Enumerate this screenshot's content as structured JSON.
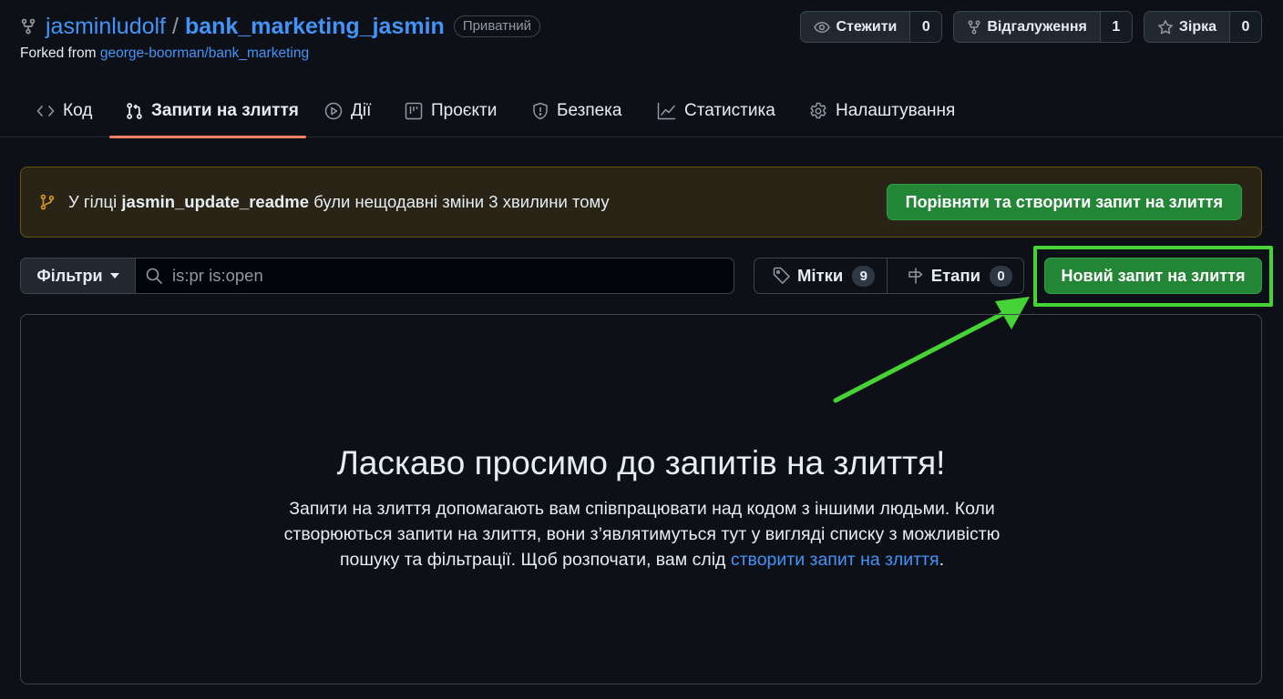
{
  "repo": {
    "owner": "jasminludolf",
    "separator": "/",
    "name": "bank_marketing_jasmin",
    "visibility": "Приватний",
    "forked_prefix": "Forked from",
    "forked_from": "george-boorman/bank_marketing"
  },
  "header_actions": {
    "watch": {
      "label": "Стежити",
      "count": "0",
      "icon": "eye-icon"
    },
    "fork": {
      "label": "Відгалуження",
      "count": "1",
      "icon": "repo-forked-icon"
    },
    "star": {
      "label": "Зірка",
      "count": "0",
      "icon": "star-icon"
    }
  },
  "tabs": [
    {
      "label": "Код",
      "icon": "code-icon"
    },
    {
      "label": "Запити на злиття",
      "icon": "git-pull-request-icon",
      "active": true
    },
    {
      "label": "Дії",
      "icon": "play-icon"
    },
    {
      "label": "Проєкти",
      "icon": "table-icon"
    },
    {
      "label": "Безпека",
      "icon": "shield-icon"
    },
    {
      "label": "Статистика",
      "icon": "graph-icon"
    },
    {
      "label": "Налаштування",
      "icon": "gear-icon"
    }
  ],
  "banner": {
    "prefix": "У гілці",
    "branch": "jasmin_update_readme",
    "suffix": "були нещодавні зміни 3 хвилини тому",
    "button": "Порівняти та створити запит на злиття"
  },
  "filter_bar": {
    "filters_label": "Фільтри",
    "search_value": "is:pr is:open",
    "labels_label": "Мітки",
    "labels_count": "9",
    "milestones_label": "Етапи",
    "milestones_count": "0",
    "new_pr_button": "Новий запит на злиття"
  },
  "empty_state": {
    "title": "Ласкаво просимо до запитів на злиття!",
    "text": "Запити на злиття допомагають вам співпрацювати над кодом з іншими людьми. Коли створюються запити на злиття, вони з’являтимуться тут у вигляді списку з можливістю пошуку та фільтрації. Щоб розпочати, вам слід",
    "link": "створити запит на злиття",
    "end": "."
  },
  "colors": {
    "background": "#0d1117",
    "link": "#4493f8",
    "primary_button": "#238636",
    "active_tab_underline": "#f78166",
    "annotation_highlight": "#45d335",
    "banner_border": "#6a5313"
  }
}
